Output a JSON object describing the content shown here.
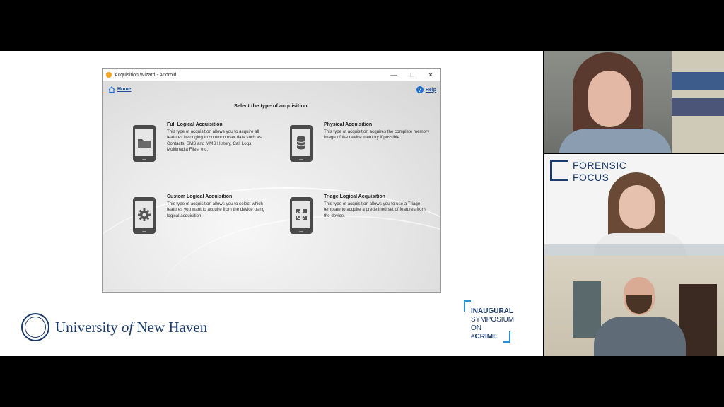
{
  "window": {
    "title": "Acquisition Wizard - Android",
    "minimize": "—",
    "maximize": "☐",
    "close": "✕"
  },
  "nav": {
    "home_label": "Home",
    "help_label": "Help",
    "help_glyph": "?"
  },
  "heading": "Select the type of acquisition:",
  "options": [
    {
      "title": "Full Logical Acquisition",
      "description": "This type of acquisition allows you to acquire all features belonging to common user data such as Contacts, SMS and MMS History, Call Logs, Multimedia Files, etc.",
      "icon": "folder-icon"
    },
    {
      "title": "Physical Acquisition",
      "description": "This type of acquisition acquires the complete memory image of the device memory if possible.",
      "icon": "database-icon"
    },
    {
      "title": "Custom Logical Acquisition",
      "description": "This type of acquisition allows you to select which features you want to acquire from the device using logical acquisition.",
      "icon": "gear-icon"
    },
    {
      "title": "Triage Logical Acquisition",
      "description": "This type of acquisition allows you to use a Triage template to acquire a predefined set of features from the device.",
      "icon": "triage-icon"
    }
  ],
  "branding": {
    "university_prefix": "University ",
    "university_of": "of",
    "university_suffix": " New Haven",
    "symposium_line1": "INAUGURAL",
    "symposium_line2": "SYMPOSIUM ON",
    "symposium_line3": "eCRIME",
    "forensic_focus_line1": "FORENSIC",
    "forensic_focus_line2": "FOCUS"
  },
  "colors": {
    "accent_blue": "#1a6fd6",
    "brand_navy": "#1b3a6b",
    "symposium_blue": "#2a8fd6"
  }
}
